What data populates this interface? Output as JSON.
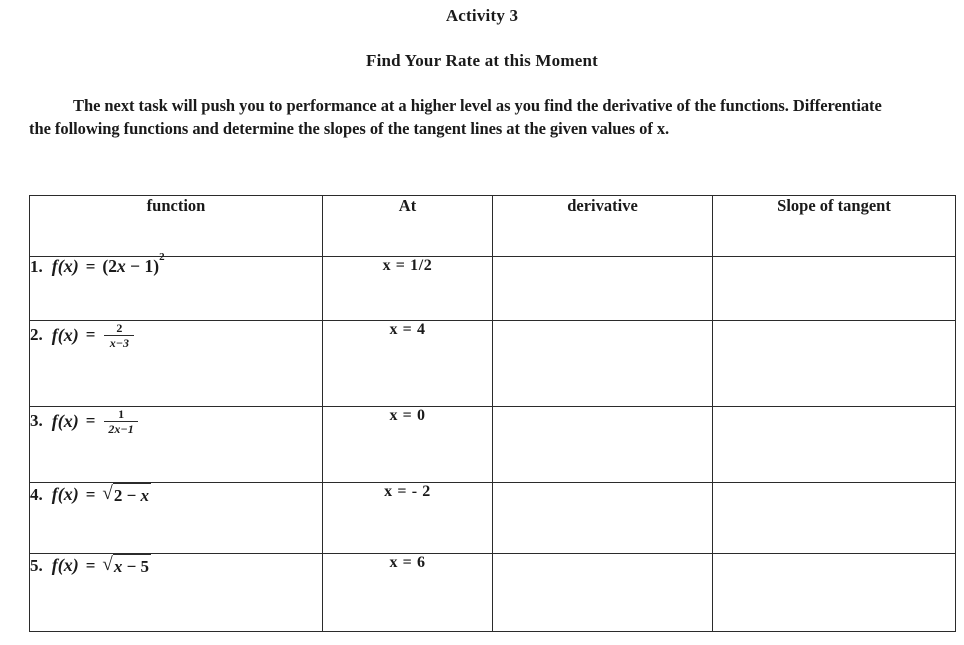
{
  "document": {
    "title": "Activity 3",
    "subtitle": "Find Your Rate at this Moment",
    "intro": "The next task will push you to performance at a higher level as you find the derivative of the functions. Differentiate the following functions and determine the slopes of the tangent lines at the given values of x."
  },
  "table": {
    "headers": {
      "function": "function",
      "at": "At",
      "derivative": "derivative",
      "slope": "Slope of tangent"
    },
    "rows": [
      {
        "index": "1.",
        "fn": "f(x)",
        "eq": "=",
        "expr_type": "power",
        "base_open": "(2",
        "base_var": "x",
        "base_rest": " − 1)",
        "exponent": "2",
        "expr_plain": "(2x − 1)²",
        "at": "x = 1/2",
        "derivative": "",
        "slope": ""
      },
      {
        "index": "2.",
        "fn": "f(x)",
        "eq": "=",
        "expr_type": "fraction",
        "numerator": "2",
        "denominator": "x−3",
        "expr_plain": "2/(x−3)",
        "at": "x = 4",
        "derivative": "",
        "slope": ""
      },
      {
        "index": "3.",
        "fn": "f(x)",
        "eq": "=",
        "expr_type": "fraction",
        "numerator": "1",
        "denominator": "2x−1",
        "expr_plain": "1/(2x−1)",
        "at": "x = 0",
        "derivative": "",
        "slope": ""
      },
      {
        "index": "4.",
        "fn": "f(x)",
        "eq": "=",
        "expr_type": "radical",
        "radicand_a": "2 − ",
        "radicand_var": "x",
        "expr_plain": "√(2 − x)",
        "at": "x = - 2",
        "derivative": "",
        "slope": ""
      },
      {
        "index": "5.",
        "fn": "f(x)",
        "eq": "=",
        "expr_type": "radical",
        "radicand_var": "x",
        "radicand_a": " − 5",
        "expr_plain": "√(x − 5)",
        "at": "x = 6",
        "derivative": "",
        "slope": ""
      }
    ]
  },
  "symbols": {
    "radical_sign": "√"
  }
}
